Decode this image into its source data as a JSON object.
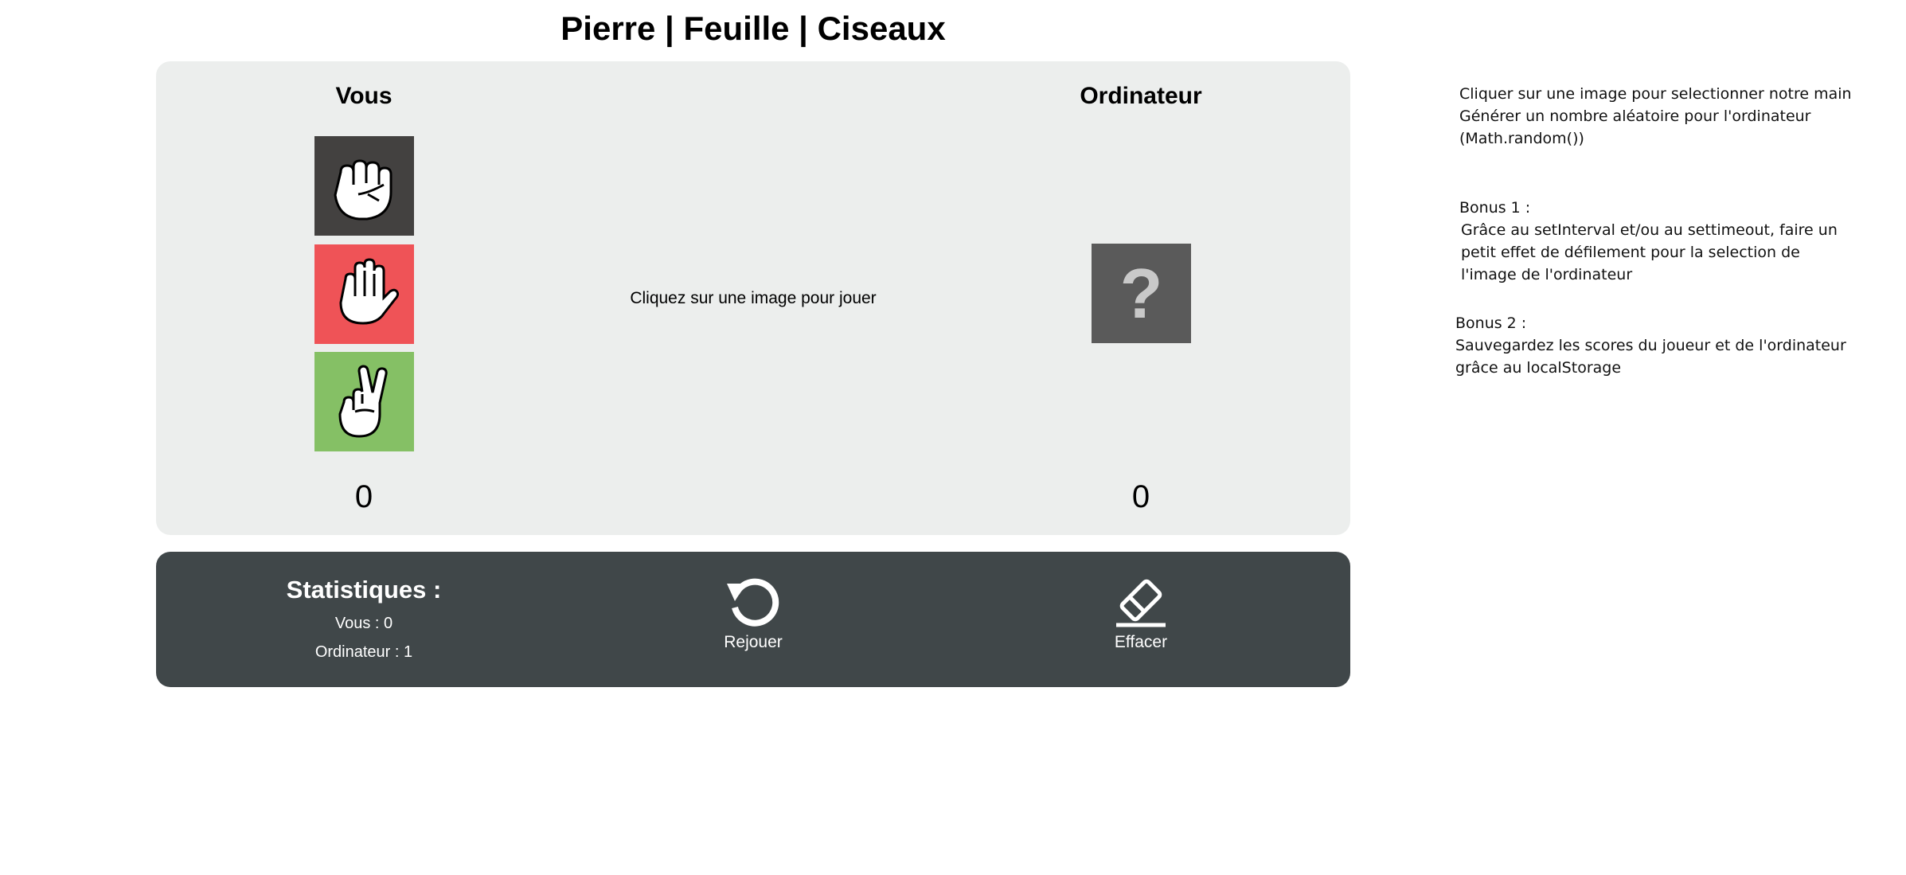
{
  "page": {
    "title": "Pierre | Feuille | Ciseaux"
  },
  "game": {
    "you_heading": "Vous",
    "cpu_heading": "Ordinateur",
    "prompt": "Cliquez sur une image pour jouer",
    "cpu_placeholder": "?",
    "you_score": "0",
    "cpu_score": "0",
    "choices": [
      {
        "name": "pierre",
        "icon": "rock-hand-icon",
        "color": "#434140"
      },
      {
        "name": "feuille",
        "icon": "paper-hand-icon",
        "color": "#ef5357"
      },
      {
        "name": "ciseaux",
        "icon": "scissors-hand-icon",
        "color": "#85c065"
      }
    ]
  },
  "stats": {
    "title": "Statistiques :",
    "you_line": "Vous : 0",
    "cpu_line": "Ordinateur : 1",
    "replay_label": "Rejouer",
    "replay_icon": "replay-icon",
    "erase_label": "Effacer",
    "erase_icon": "eraser-icon"
  },
  "instructions": {
    "block1": [
      "Cliquer sur une image pour selectionner notre main",
      "Générer un nombre aléatoire pour l'ordinateur",
      "(Math.random())"
    ],
    "block2": [
      "Bonus 1 :",
      "Grâce au setInterval et/ou au settimeout, faire un",
      "petit effet de défilement pour la selection de",
      "l'image de l'ordinateur"
    ],
    "block3": [
      "Bonus 2 :",
      "Sauvegardez les scores du joueur et de l'ordinateur",
      "grâce au localStorage"
    ]
  },
  "colors": {
    "panel_bg": "#eceeed",
    "stats_bg": "#404749",
    "cpu_tile_bg": "#5a5a5a"
  }
}
